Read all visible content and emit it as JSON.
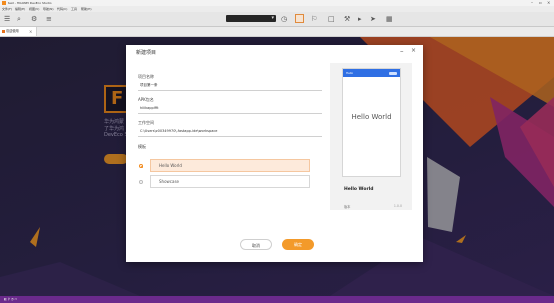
{
  "window": {
    "title": "test - HUAWEI DevEco Studio"
  },
  "menubar": {
    "items": [
      "文件(F)",
      "编辑(E)",
      "视图(V)",
      "导航(N)",
      "代码(C)",
      "工具",
      "帮助(H)"
    ]
  },
  "tabs": [
    {
      "label": "欢迎使用"
    }
  ],
  "welcome": {
    "logo_glyph": "F",
    "lines": [
      "华为鸿蒙",
      "了华为鸿",
      "DevEco S"
    ]
  },
  "dialog": {
    "title": "新建项目",
    "fields": [
      {
        "label": "项目名称",
        "value": "项目第一条"
      },
      {
        "label": "APK包名",
        "value": "hiiikapplfft"
      },
      {
        "label": "工作空间",
        "value": "C:\\Users\\z00349970\\.fastapp-ide\\workspace"
      }
    ],
    "template_label": "模板",
    "templates": [
      {
        "label": "Hello World",
        "selected": true
      },
      {
        "label": "Showcase",
        "selected": false
      }
    ],
    "preview": {
      "phone_bar_text": "Hello",
      "phone_text": "Hello World",
      "name": "Hello World",
      "meta_key": "版本",
      "meta_value": "1.0.0"
    },
    "buttons": {
      "cancel": "取消",
      "ok": "确定"
    }
  },
  "colors": {
    "accent": "#f39a2a",
    "status_bar": "#6b2a8c",
    "preview_bar": "#2f6fe4"
  }
}
